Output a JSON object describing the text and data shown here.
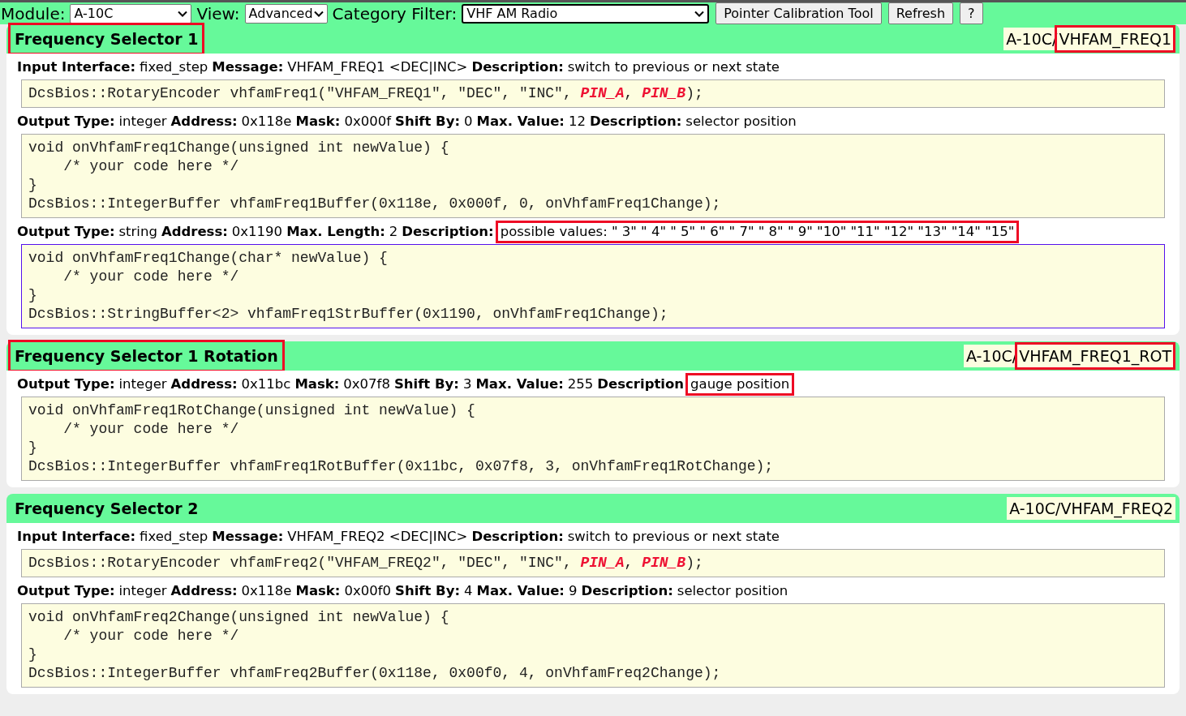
{
  "toolbar": {
    "module_label": "Module:",
    "module": "A-10C",
    "view_label": "View:",
    "view": "Advanced",
    "category_label": "Category Filter:",
    "category": "VHF AM Radio",
    "buttons": [
      "Pointer Calibration Tool",
      "Refresh",
      "?"
    ]
  },
  "controls": [
    {
      "title": "Frequency Selector 1",
      "title_highlighted": true,
      "id_prefix": "A-10C/",
      "id_name": "VHFAM_FREQ1",
      "id_highlighted": true,
      "blocks": [
        {
          "fields": [
            {
              "label": "Input Interface:",
              "value": "fixed_step",
              "highlighted": false
            },
            {
              "label": "Message:",
              "value": "VHFAM_FREQ1 <DEC|INC>",
              "highlighted": false
            },
            {
              "label": "Description:",
              "value": "switch to previous or next state",
              "highlighted": false
            }
          ],
          "selected": false,
          "code": [
            "DcsBios::RotaryEncoder vhfamFreq1(\"VHFAM_FREQ1\", \"DEC\", \"INC\", **PIN_A**, **PIN_B**);"
          ]
        },
        {
          "fields": [
            {
              "label": "Output Type:",
              "value": "integer",
              "highlighted": false
            },
            {
              "label": "Address:",
              "value": "0x118e",
              "highlighted": false
            },
            {
              "label": "Mask:",
              "value": "0x000f",
              "highlighted": false
            },
            {
              "label": "Shift By:",
              "value": "0",
              "highlighted": false
            },
            {
              "label": "Max. Value:",
              "value": "12",
              "highlighted": false
            },
            {
              "label": "Description:",
              "value": "selector position",
              "highlighted": false
            }
          ],
          "selected": false,
          "code": [
            "void onVhfamFreq1Change(unsigned int newValue) {",
            "    /* your code here */",
            "}",
            "DcsBios::IntegerBuffer vhfamFreq1Buffer(0x118e, 0x000f, 0, onVhfamFreq1Change);"
          ]
        },
        {
          "fields": [
            {
              "label": "Output Type:",
              "value": "string",
              "highlighted": false
            },
            {
              "label": "Address:",
              "value": "0x1190",
              "highlighted": false
            },
            {
              "label": "Max. Length:",
              "value": "2",
              "highlighted": false
            },
            {
              "label": "Description:",
              "value": "possible values: \" 3\" \" 4\" \" 5\" \" 6\" \" 7\" \" 8\" \" 9\" \"10\" \"11\" \"12\" \"13\" \"14\" \"15\"",
              "highlighted": true
            }
          ],
          "selected": true,
          "code": [
            "void onVhfamFreq1Change(char* newValue) {",
            "    /* your code here */",
            "}",
            "DcsBios::StringBuffer<2> vhfamFreq1StrBuffer(0x1190, onVhfamFreq1Change);"
          ]
        }
      ]
    },
    {
      "title": "Frequency Selector 1 Rotation",
      "title_highlighted": true,
      "id_prefix": "A-10C/",
      "id_name": "VHFAM_FREQ1_ROT",
      "id_highlighted": true,
      "blocks": [
        {
          "fields": [
            {
              "label": "Output Type:",
              "value": "integer",
              "highlighted": false
            },
            {
              "label": "Address:",
              "value": "0x11bc",
              "highlighted": false
            },
            {
              "label": "Mask:",
              "value": "0x07f8",
              "highlighted": false
            },
            {
              "label": "Shift By:",
              "value": "3",
              "highlighted": false
            },
            {
              "label": "Max. Value:",
              "value": "255",
              "highlighted": false
            },
            {
              "label": "Description",
              "value": "gauge position",
              "highlighted": true
            }
          ],
          "selected": false,
          "code": [
            "void onVhfamFreq1RotChange(unsigned int newValue) {",
            "    /* your code here */",
            "}",
            "DcsBios::IntegerBuffer vhfamFreq1RotBuffer(0x11bc, 0x07f8, 3, onVhfamFreq1RotChange);"
          ]
        }
      ]
    },
    {
      "title": "Frequency Selector 2",
      "title_highlighted": false,
      "id_prefix": "A-10C/",
      "id_name": "VHFAM_FREQ2",
      "id_highlighted": false,
      "blocks": [
        {
          "fields": [
            {
              "label": "Input Interface:",
              "value": "fixed_step",
              "highlighted": false
            },
            {
              "label": "Message:",
              "value": "VHFAM_FREQ2 <DEC|INC>",
              "highlighted": false
            },
            {
              "label": "Description:",
              "value": "switch to previous or next state",
              "highlighted": false
            }
          ],
          "selected": false,
          "code": [
            "DcsBios::RotaryEncoder vhfamFreq2(\"VHFAM_FREQ2\", \"DEC\", \"INC\", **PIN_A**, **PIN_B**);"
          ]
        },
        {
          "fields": [
            {
              "label": "Output Type:",
              "value": "integer",
              "highlighted": false
            },
            {
              "label": "Address:",
              "value": "0x118e",
              "highlighted": false
            },
            {
              "label": "Mask:",
              "value": "0x00f0",
              "highlighted": false
            },
            {
              "label": "Shift By:",
              "value": "4",
              "highlighted": false
            },
            {
              "label": "Max. Value:",
              "value": "9",
              "highlighted": false
            },
            {
              "label": "Description:",
              "value": "selector position",
              "highlighted": false
            }
          ],
          "selected": false,
          "code": [
            "void onVhfamFreq2Change(unsigned int newValue) {",
            "    /* your code here */",
            "}",
            "DcsBios::IntegerBuffer vhfamFreq2Buffer(0x118e, 0x00f0, 4, onVhfamFreq2Change);"
          ]
        }
      ]
    }
  ]
}
